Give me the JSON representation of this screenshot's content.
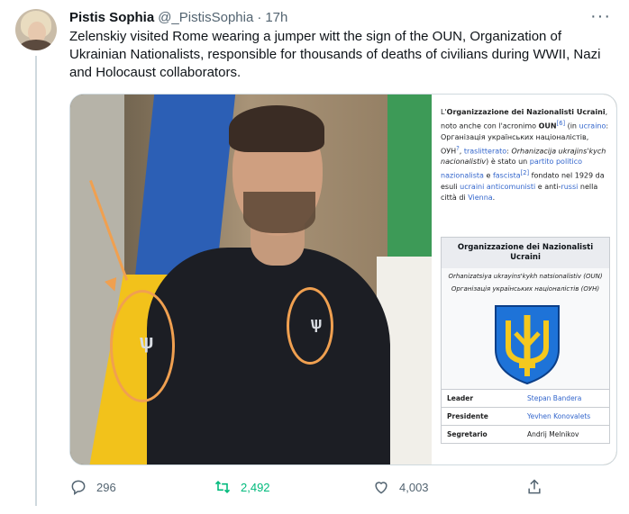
{
  "tweet": {
    "author_name": "Pistis Sophia",
    "author_handle": "@_PistisSophia",
    "separator": "·",
    "time": "17h",
    "more_icon": "more-icon",
    "text": "Zelenskiy visited Rome wearing a jumper witt the sign of the OUN, Organization of Ukrainian Nationalists, responsible for thousands of deaths of civilians during WWII, Nazi and Holocaust collaborators."
  },
  "wiki_image": {
    "intro": {
      "p1": "L'",
      "p1_bold": "Organizzazione dei Nazionalisti Ucraini",
      "p2": ", noto anche con l'acronimo ",
      "p2_bold": "OUN",
      "p2_sup": "[6]",
      "p3": " (in ",
      "link_ucraino": "ucraino",
      "p4": ": Організація українських націоналістів, ОУН",
      "p4_sup": "?",
      "p5": ", ",
      "link_traslitterato": "traslitterato",
      "p6": ": ",
      "italic_translit": "Orhanizacija ukrajins'kych nacionalistiv",
      "p7": ") è stato un ",
      "link_partito": "partito politico nazionalista",
      "p8": " e ",
      "link_fascista": "fascista",
      "p8_sup": "[2]",
      "p9": " fondato nel 1929 da esuli ",
      "link_ucraini": "ucraini",
      "p10": " ",
      "link_anticomunisti": "anticomunisti",
      "p11": " e anti-",
      "link_russi": "russi",
      "p12": " nella città di ",
      "link_vienna": "Vienna",
      "p13": "."
    },
    "infobox": {
      "title": "Organizzazione dei Nazionalisti Ucraini",
      "sub1": "Orhanizatsiya ukrayins'kykh natsionalistiv (OUN)",
      "sub2": "Організація українських націоналістів (ОУН)",
      "emblem_colors": {
        "shield": "#1e73d8",
        "trident": "#f4c81e"
      },
      "rows": [
        {
          "key": "Leader",
          "value": "Stepan Bandera"
        },
        {
          "key": "Presidente",
          "value": "Yevhen Konovalets"
        },
        {
          "key": "Segretario",
          "value": "Andrij Melnikov"
        }
      ]
    }
  },
  "actions": {
    "reply_icon": "reply-icon",
    "reply_count": "296",
    "retweet_icon": "retweet-icon",
    "retweet_count": "2,492",
    "like_icon": "like-icon",
    "like_count": "4,003",
    "share_icon": "share-icon"
  },
  "colors": {
    "accent_retweet": "#00ba7c",
    "muted": "#536471",
    "annotation": "#f0a050",
    "link": "#3366cc"
  }
}
